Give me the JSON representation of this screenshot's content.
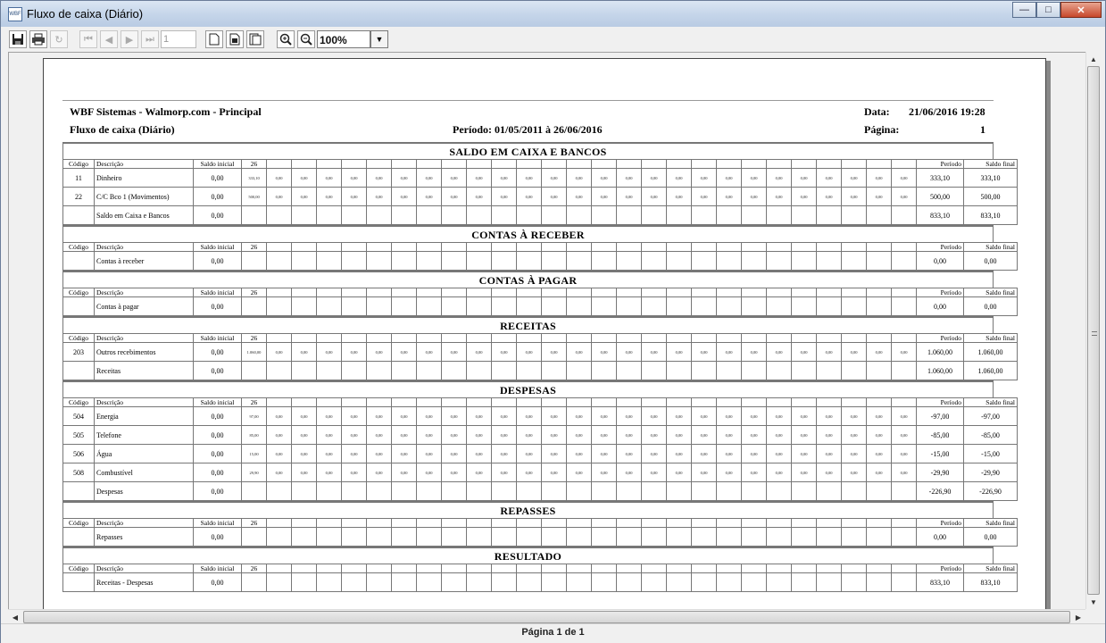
{
  "window": {
    "title": "Fluxo de caixa (Diário)",
    "icon": "wbf-app-icon",
    "icon_text": "WBF"
  },
  "toolbar": {
    "page_number": "1",
    "zoom": "100%"
  },
  "header": {
    "company": "WBF Sistemas - Walmorp.com - Principal",
    "report_name": "Fluxo de caixa (Diário)",
    "periodo": "Período: 01/05/2011 à 26/06/2016",
    "data_label": "Data:",
    "data_value": "21/06/2016 19:28",
    "pagina_label": "Página:",
    "pagina_value": "1"
  },
  "columns": {
    "codigo": "Código",
    "descricao": "Descrição",
    "saldo_inicial": "Saldo inicial",
    "dia": "26",
    "periodo": "Período",
    "saldo_final": "Saldo final"
  },
  "sections": [
    {
      "title": "SALDO EM CAIXA E BANCOS",
      "rows": [
        {
          "codigo": "11",
          "descricao": "Dinheiro",
          "saldo_inicial": "0,00",
          "dia": "333,10",
          "periodo": "333,10",
          "saldo_final": "333,10",
          "days": true
        },
        {
          "codigo": "22",
          "descricao": "C/C Bco 1 (Movimentos)",
          "saldo_inicial": "0,00",
          "dia": "500,00",
          "periodo": "500,00",
          "saldo_final": "500,00",
          "days": true
        },
        {
          "codigo": "",
          "descricao": "Saldo em Caixa e Bancos",
          "saldo_inicial": "0,00",
          "dia": "",
          "periodo": "833,10",
          "saldo_final": "833,10",
          "days": false
        }
      ]
    },
    {
      "title": "CONTAS À RECEBER",
      "rows": [
        {
          "codigo": "",
          "descricao": "Contas à receber",
          "saldo_inicial": "0,00",
          "dia": "",
          "periodo": "0,00",
          "saldo_final": "0,00",
          "days": false
        }
      ]
    },
    {
      "title": "CONTAS À PAGAR",
      "rows": [
        {
          "codigo": "",
          "descricao": "Contas à pagar",
          "saldo_inicial": "0,00",
          "dia": "",
          "periodo": "0,00",
          "saldo_final": "0,00",
          "days": false
        }
      ]
    },
    {
      "title": "RECEITAS",
      "rows": [
        {
          "codigo": "203",
          "descricao": "Outros recebimentos",
          "saldo_inicial": "0,00",
          "dia": "1.060,00",
          "periodo": "1.060,00",
          "saldo_final": "1.060,00",
          "days": true
        },
        {
          "codigo": "",
          "descricao": "Receitas",
          "saldo_inicial": "0,00",
          "dia": "",
          "periodo": "1.060,00",
          "saldo_final": "1.060,00",
          "days": false
        }
      ]
    },
    {
      "title": "DESPESAS",
      "rows": [
        {
          "codigo": "504",
          "descricao": "Energia",
          "saldo_inicial": "0,00",
          "dia": "97,00",
          "periodo": "-97,00",
          "saldo_final": "-97,00",
          "days": true
        },
        {
          "codigo": "505",
          "descricao": "Telefone",
          "saldo_inicial": "0,00",
          "dia": "85,00",
          "periodo": "-85,00",
          "saldo_final": "-85,00",
          "days": true
        },
        {
          "codigo": "506",
          "descricao": "Água",
          "saldo_inicial": "0,00",
          "dia": "15,00",
          "periodo": "-15,00",
          "saldo_final": "-15,00",
          "days": true
        },
        {
          "codigo": "508",
          "descricao": "Combustível",
          "saldo_inicial": "0,00",
          "dia": "29,90",
          "periodo": "-29,90",
          "saldo_final": "-29,90",
          "days": true
        },
        {
          "codigo": "",
          "descricao": "Despesas",
          "saldo_inicial": "0,00",
          "dia": "",
          "periodo": "-226,90",
          "saldo_final": "-226,90",
          "days": false
        }
      ]
    },
    {
      "title": "REPASSES",
      "rows": [
        {
          "codigo": "",
          "descricao": "Repasses",
          "saldo_inicial": "0,00",
          "dia": "",
          "periodo": "0,00",
          "saldo_final": "0,00",
          "days": false
        }
      ]
    },
    {
      "title": "RESULTADO",
      "rows": [
        {
          "codigo": "",
          "descricao": "Receitas - Despesas",
          "saldo_inicial": "0,00",
          "dia": "",
          "periodo": "833,10",
          "saldo_final": "833,10",
          "days": false
        }
      ]
    }
  ],
  "zero_value": "0,00",
  "status": {
    "page_info": "Página 1 de 1"
  }
}
